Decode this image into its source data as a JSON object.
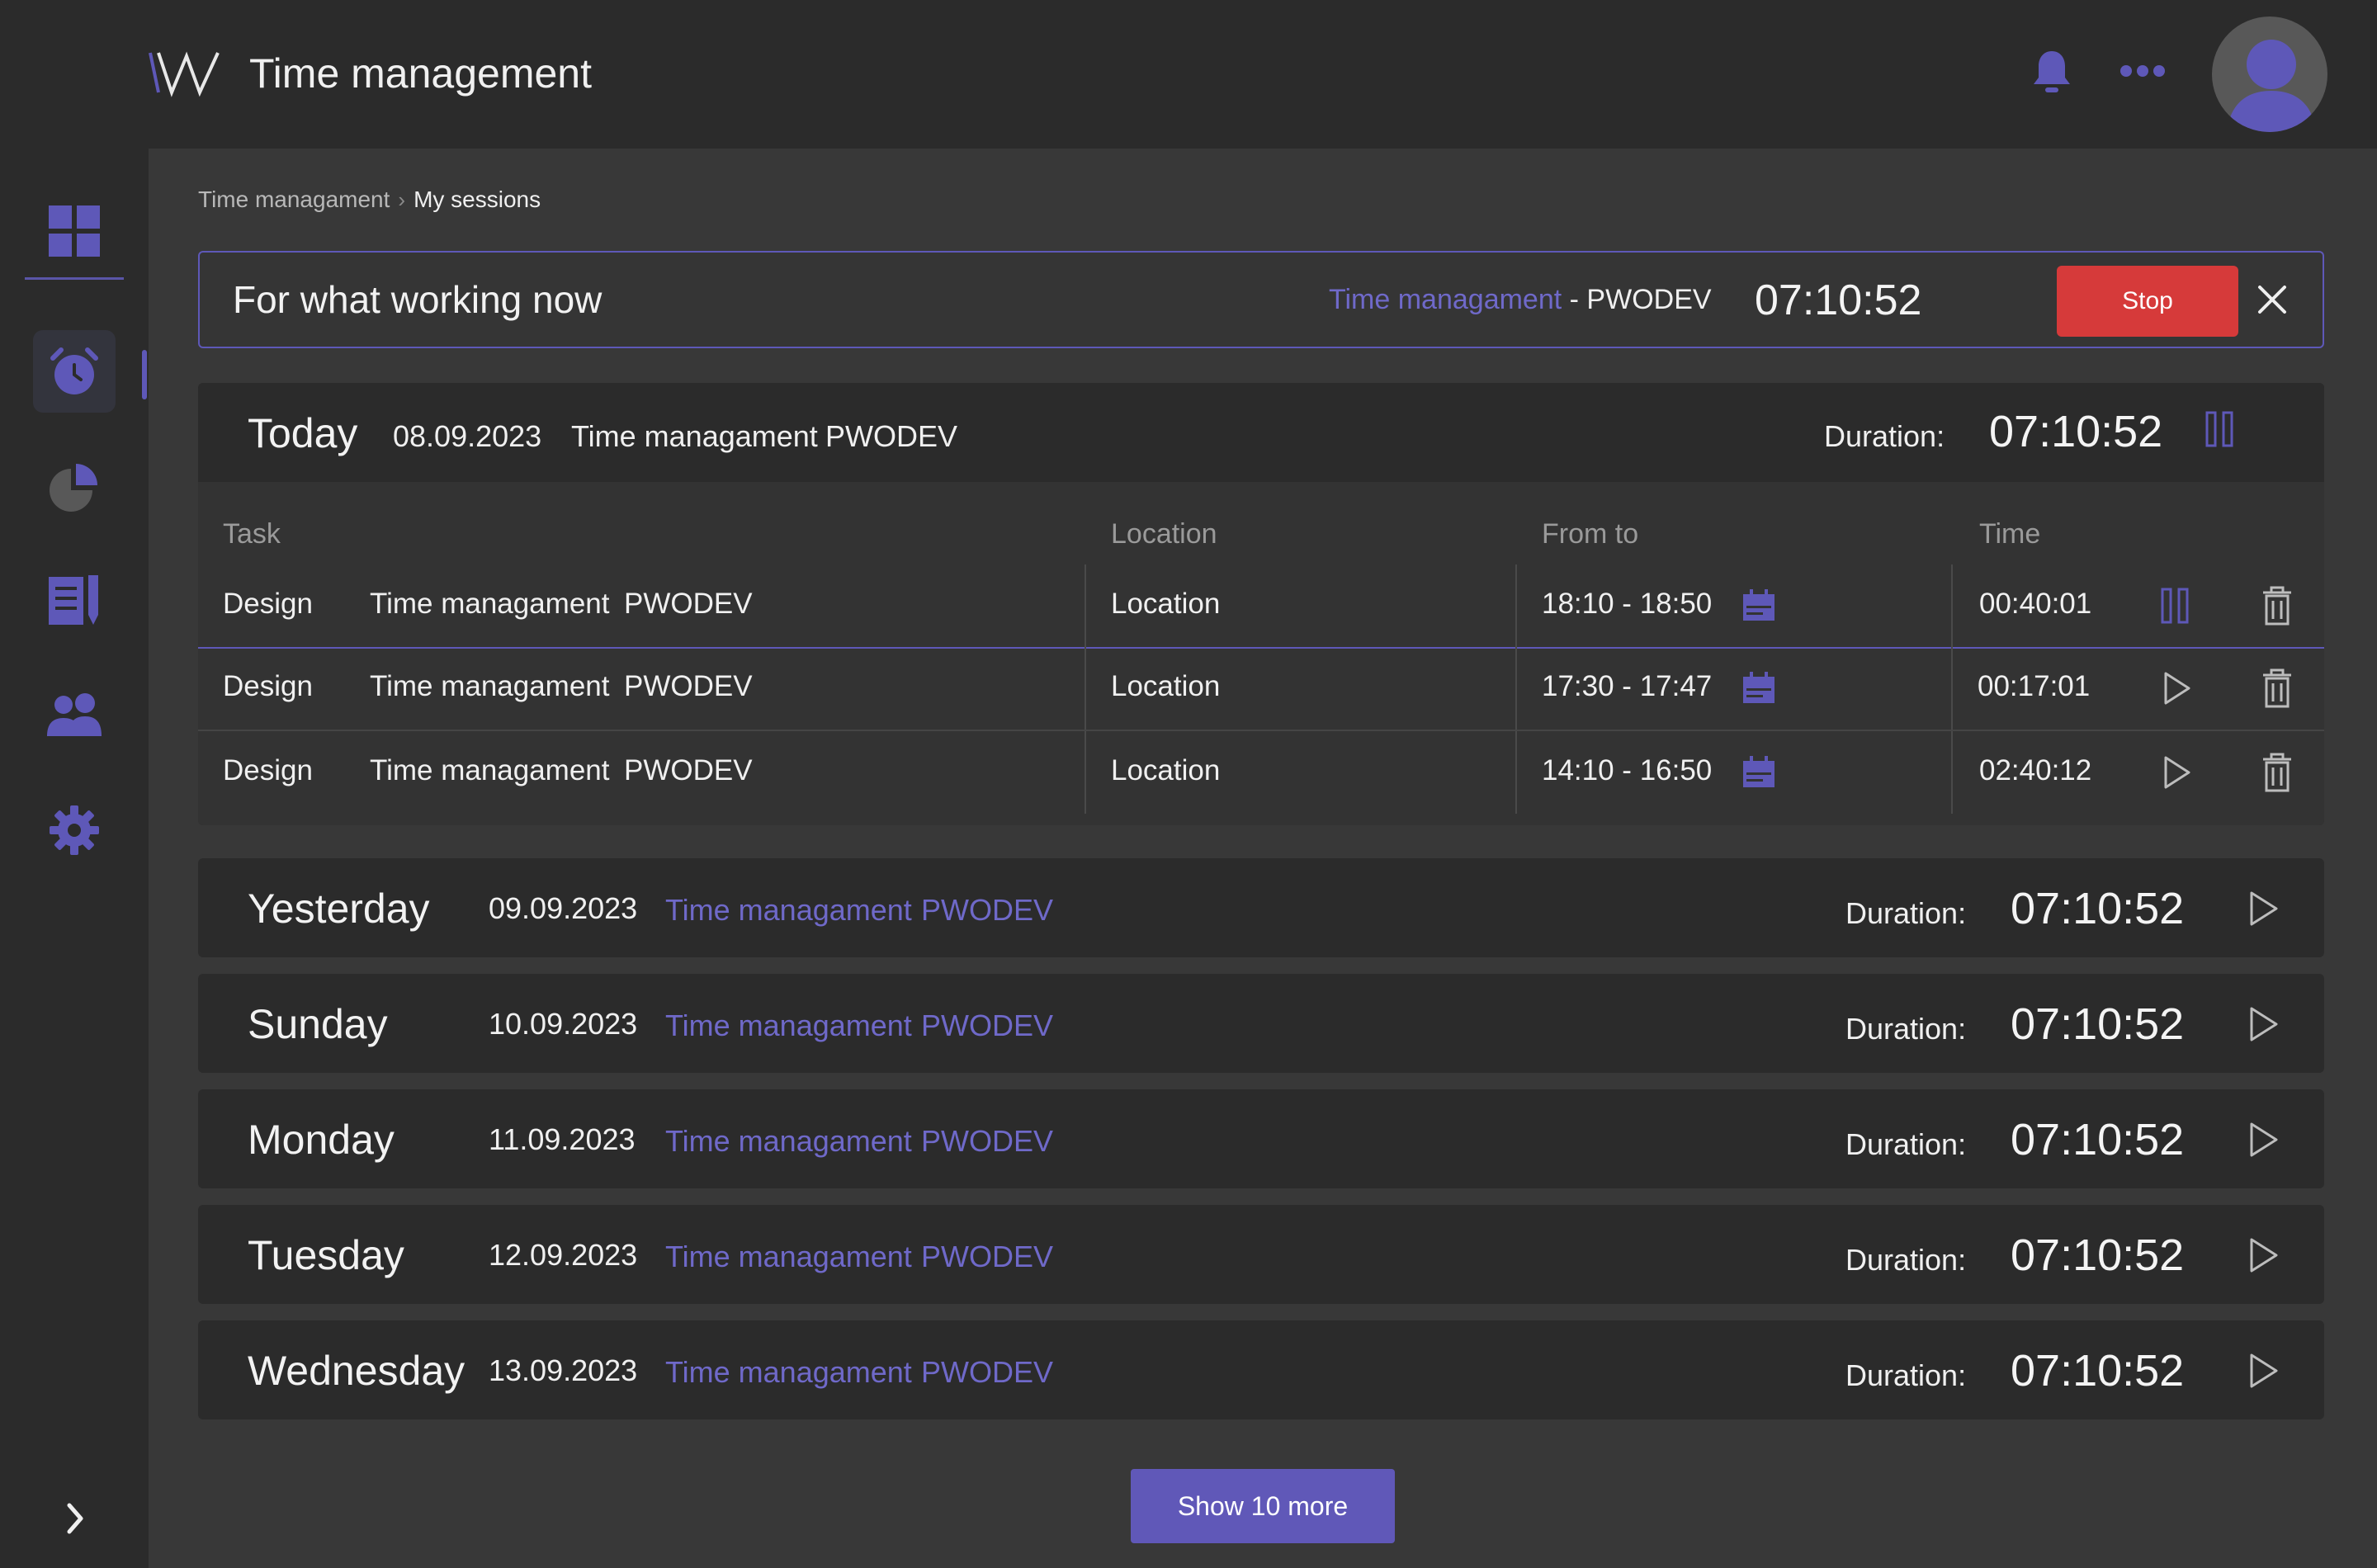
{
  "header": {
    "title": "Time management"
  },
  "breadcrumb": {
    "parent": "Time managament",
    "separator": "›",
    "current": "My sessions"
  },
  "active_session": {
    "title": "For what working now",
    "project": "Time managament",
    "dash": " - ",
    "client": "PWODEV",
    "timer": "07:10:52",
    "stop_label": "Stop"
  },
  "today": {
    "day": "Today",
    "date": "08.09.2023",
    "project": "Time managament",
    "client": "PWODEV",
    "duration_label": "Duration:",
    "duration": "07:10:52",
    "columns": {
      "task": "Task",
      "location": "Location",
      "from_to": "From to",
      "time": "Time"
    },
    "rows": [
      {
        "task": "Design",
        "project": "Time managament",
        "client": "PWODEV",
        "location": "Location",
        "range": "18:10 - 18:50",
        "time": "00:40:01",
        "state": "running"
      },
      {
        "task": "Design",
        "project": "Time managament",
        "client": "PWODEV",
        "location": "Location",
        "range": "17:30 - 17:47",
        "time": "00:17:01",
        "state": "stopped"
      },
      {
        "task": "Design",
        "project": "Time managament",
        "client": "PWODEV",
        "location": "Location",
        "range": "14:10 - 16:50",
        "time": "02:40:12",
        "state": "stopped"
      }
    ]
  },
  "days": [
    {
      "day": "Yesterday",
      "date": "09.09.2023",
      "project": "Time managament",
      "client": "PWODEV",
      "duration_label": "Duration:",
      "duration": "07:10:52"
    },
    {
      "day": "Sunday",
      "date": "10.09.2023",
      "project": "Time managament",
      "client": "PWODEV",
      "duration_label": "Duration:",
      "duration": "07:10:52"
    },
    {
      "day": "Monday",
      "date": "11.09.2023",
      "project": "Time managament",
      "client": "PWODEV",
      "duration_label": "Duration:",
      "duration": "07:10:52"
    },
    {
      "day": "Tuesday",
      "date": "12.09.2023",
      "project": "Time managament",
      "client": "PWODEV",
      "duration_label": "Duration:",
      "duration": "07:10:52"
    },
    {
      "day": "Wednesday",
      "date": "13.09.2023",
      "project": "Time managament",
      "client": "PWODEV",
      "duration_label": "Duration:",
      "duration": "07:10:52"
    }
  ],
  "show_more": "Show 10 more",
  "icons": {
    "logo": "logo-icon",
    "notifications": "bell-icon",
    "more": "more-dots-icon",
    "avatar": "user-avatar-icon",
    "nav": [
      "dashboard-icon",
      "alarm-clock-icon",
      "pie-chart-icon",
      "report-edit-icon",
      "users-icon",
      "settings-gear-icon"
    ],
    "expand": "chevron-right-icon",
    "close": "close-icon",
    "calendar": "calendar-icon",
    "pause": "pause-icon",
    "play": "play-icon",
    "delete": "trash-icon"
  },
  "colors": {
    "accent": "#6058b8",
    "stop": "#d63a3a",
    "background": "#383838",
    "panel": "#2b2b2b"
  }
}
